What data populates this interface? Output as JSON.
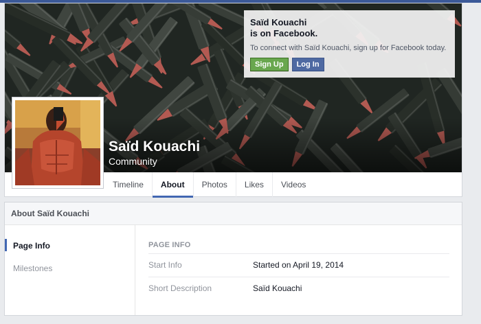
{
  "colors": {
    "facebook_blue": "#3b5998",
    "tab_underline": "#4267b2",
    "signup_green": "#69a74e",
    "login_blue": "#4e69a2"
  },
  "cover": {
    "image": "cover-photo-bullets"
  },
  "join_box": {
    "title": "Saïd Kouachi\nis on Facebook.",
    "subtitle": "To connect with Saïd Kouachi, sign up for Facebook today.",
    "signup_label": "Sign Up",
    "login_label": "Log In"
  },
  "profile": {
    "name": "Saïd Kouachi",
    "category": "Community",
    "avatar": "profile-picture"
  },
  "tabs": [
    {
      "label": "Timeline",
      "active": false
    },
    {
      "label": "About",
      "active": true
    },
    {
      "label": "Photos",
      "active": false
    },
    {
      "label": "Likes",
      "active": false
    },
    {
      "label": "Videos",
      "active": false
    }
  ],
  "about": {
    "header": "About Saïd Kouachi",
    "sidebar": [
      {
        "label": "Page Info",
        "active": true
      },
      {
        "label": "Milestones",
        "active": false
      }
    ],
    "section_title": "PAGE INFO",
    "rows": [
      {
        "label": "Start Info",
        "value": "Started on April 19, 2014"
      },
      {
        "label": "Short Description",
        "value": "Saïd Kouachi"
      }
    ]
  }
}
